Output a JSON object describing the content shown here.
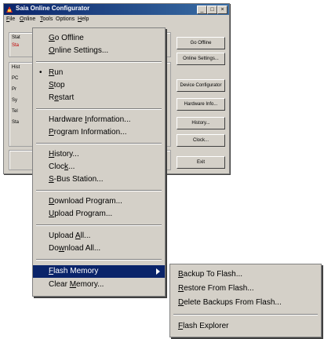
{
  "window": {
    "title": "Saia Online Configurator",
    "controls": {
      "minimize": "_",
      "maximize": "□",
      "close": "×"
    }
  },
  "menubar": {
    "items": [
      {
        "label": "File",
        "key": "F",
        "rest": "ile"
      },
      {
        "label": "Online",
        "key": "O",
        "rest": "nline"
      },
      {
        "label": "Tools",
        "key": "T",
        "rest": "ools"
      },
      {
        "label": "Options",
        "key": "",
        "rest": "Options"
      },
      {
        "label": "Help",
        "key": "H",
        "rest": "elp"
      }
    ]
  },
  "side_buttons": [
    "Go Offline",
    "Online Settings...",
    "Device Configurator",
    "Hardware Info...",
    "History...",
    "Clock...",
    "Exit"
  ],
  "background_fragments": [
    "Stat",
    "Sta",
    "Hist",
    "PC",
    "Pr",
    "Sy",
    "Tel",
    "Sta"
  ],
  "menu": {
    "items": [
      {
        "pre": "",
        "key": "G",
        "post": "o Offline"
      },
      {
        "pre": "",
        "key": "O",
        "post": "nline Settings..."
      },
      {
        "pre": "",
        "key": "R",
        "post": "un"
      },
      {
        "pre": "",
        "key": "S",
        "post": "top"
      },
      {
        "pre": "R",
        "key": "e",
        "post": "start"
      },
      {
        "pre": "Hardware ",
        "key": "I",
        "post": "nformation..."
      },
      {
        "pre": "",
        "key": "P",
        "post": "rogram Information..."
      },
      {
        "pre": "",
        "key": "H",
        "post": "istory..."
      },
      {
        "pre": "Cloc",
        "key": "k",
        "post": "..."
      },
      {
        "pre": "",
        "key": "S",
        "post": "-Bus Station..."
      },
      {
        "pre": "",
        "key": "D",
        "post": "ownload Program..."
      },
      {
        "pre": "",
        "key": "U",
        "post": "pload Program..."
      },
      {
        "pre": "Upload ",
        "key": "A",
        "post": "ll..."
      },
      {
        "pre": "Do",
        "key": "w",
        "post": "nload All..."
      },
      {
        "pre": "",
        "key": "F",
        "post": "lash Memory"
      },
      {
        "pre": "Clear ",
        "key": "M",
        "post": "emory..."
      }
    ],
    "bullet": "•"
  },
  "submenu": {
    "items": [
      {
        "pre": "",
        "key": "B",
        "post": "ackup To Flash..."
      },
      {
        "pre": "",
        "key": "R",
        "post": "estore From Flash..."
      },
      {
        "pre": "",
        "key": "D",
        "post": "elete Backups From Flash..."
      },
      {
        "pre": "",
        "key": "F",
        "post": "lash Explorer"
      }
    ]
  },
  "colors": {
    "highlight": "#0a246a",
    "face": "#d4d0c8",
    "title_start": "#0a246a",
    "title_end": "#3a6ea5"
  }
}
